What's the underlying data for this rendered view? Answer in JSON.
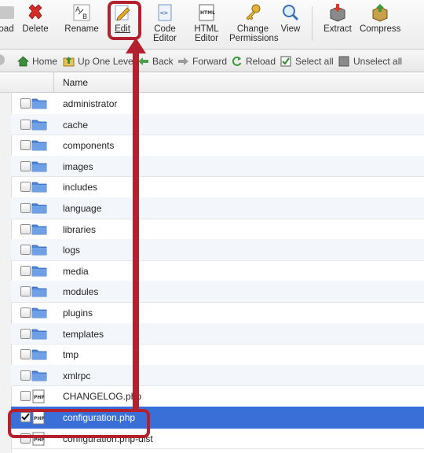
{
  "toolbar": {
    "upload_label": "oad",
    "delete_label": "Delete",
    "rename_label": "Rename",
    "edit_label": "Edit",
    "code_editor_line1": "Code",
    "code_editor_line2": "Editor",
    "html_editor_line1": "HTML",
    "html_editor_line2": "Editor",
    "change_perm_line1": "Change",
    "change_perm_line2": "Permissions",
    "view_label": "View",
    "extract_label": "Extract",
    "compress_label": "Compress"
  },
  "navbar": {
    "home": "Home",
    "up_one_level": "Up One Level",
    "back": "Back",
    "forward": "Forward",
    "reload": "Reload",
    "select_all": "Select all",
    "unselect_all": "Unselect all"
  },
  "table": {
    "name_header": "Name",
    "rows": [
      {
        "name": "administrator"
      },
      {
        "name": "cache"
      },
      {
        "name": "components"
      },
      {
        "name": "images"
      },
      {
        "name": "includes"
      },
      {
        "name": "language"
      },
      {
        "name": "libraries"
      },
      {
        "name": "logs"
      },
      {
        "name": "media"
      },
      {
        "name": "modules"
      },
      {
        "name": "plugins"
      },
      {
        "name": "templates"
      },
      {
        "name": "tmp"
      },
      {
        "name": "xmlrpc"
      },
      {
        "name": "CHANGELOG.php"
      },
      {
        "name": "configuration.php"
      },
      {
        "name": "configuration.php-dist"
      }
    ]
  },
  "colors": {
    "highlight": "#b3212f",
    "selected_row": "#3a6fd8",
    "folder": "#4f86d9"
  }
}
